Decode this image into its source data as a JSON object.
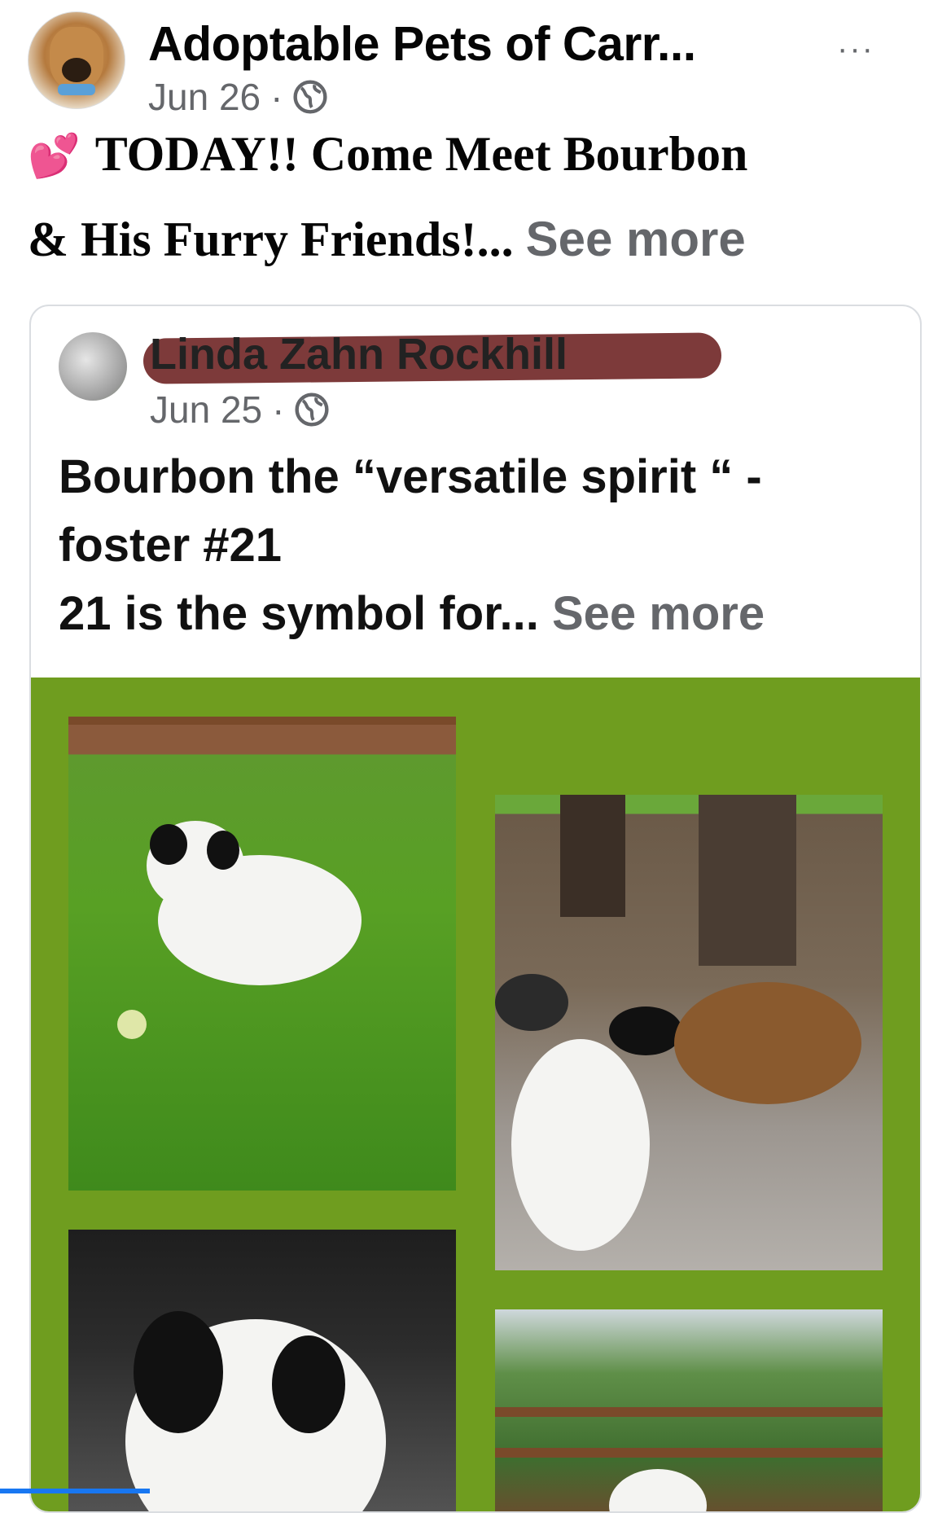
{
  "post": {
    "page_name": "Adoptable Pets of Carr...",
    "date": "Jun 26",
    "dot": "·",
    "more_icon": "···",
    "emoji": "💕",
    "text_line1": "TODAY!! Come Meet Bourbon",
    "text_line2": "& His Furry Friends!...",
    "see_more": "See more"
  },
  "shared": {
    "author_name": "Linda Zahn Rockhill",
    "date": "Jun 25",
    "dot": "·",
    "text_line1": "Bourbon the “versatile spirit “ -",
    "text_line2": "foster #21",
    "text_line3": "21 is the symbol for...",
    "see_more": "See more"
  },
  "colors": {
    "grid_background": "#6f9d1f",
    "see_more": "#65676b",
    "redaction": "#6b1f1f"
  },
  "icons": {
    "privacy": "globe-icon",
    "options": "more-options-icon"
  }
}
